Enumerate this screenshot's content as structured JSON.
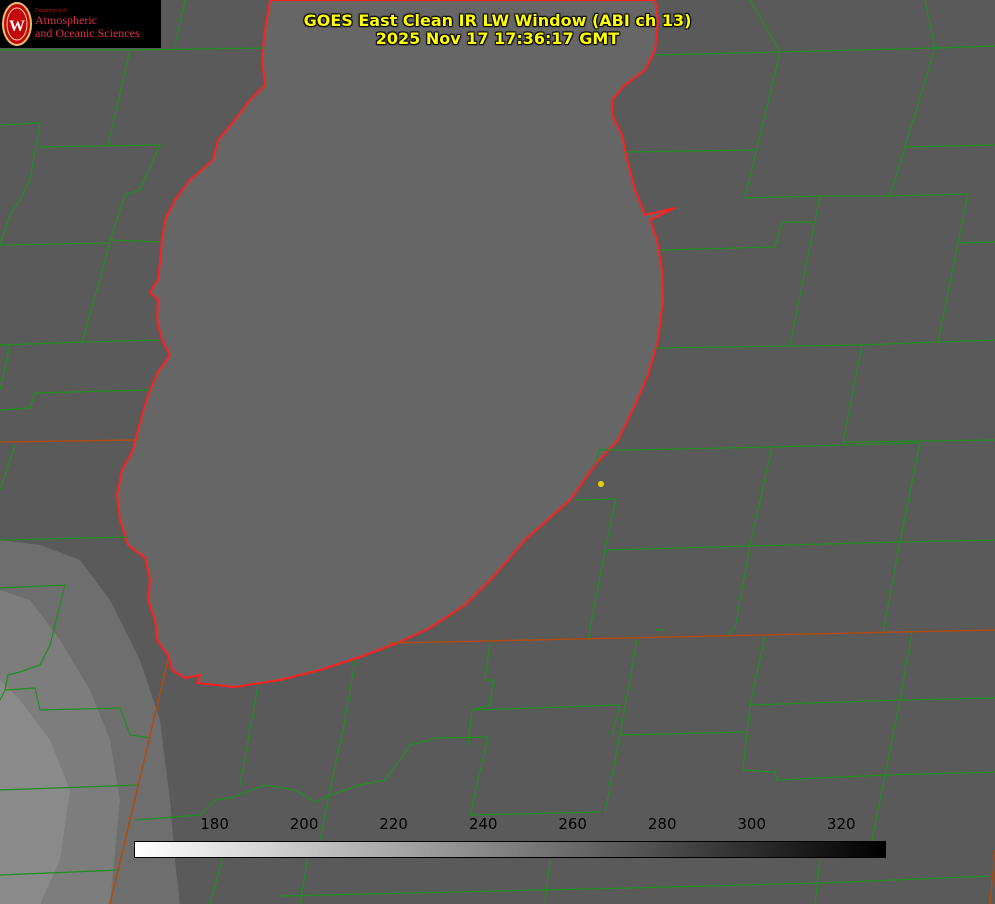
{
  "header": {
    "title_line1": "GOES East Clean IR LW Window (ABI ch 13)",
    "title_line2": "2025 Nov 17 17:36:17 GMT"
  },
  "logo": {
    "seal_letter": "W",
    "department": "Department of",
    "line1": "Atmospheric",
    "line2": "and Oceanic Sciences",
    "color": "#c5050c"
  },
  "colorbar": {
    "ticks": [
      "180",
      "200",
      "220",
      "240",
      "260",
      "280",
      "300",
      "320"
    ],
    "tick_values": [
      180,
      200,
      220,
      240,
      260,
      280,
      300,
      320
    ],
    "range": [
      162,
      330
    ],
    "start_color": "#ffffff",
    "end_color": "#000000"
  },
  "colors": {
    "coastline": "#ff2020",
    "county_lines": "#1f8f1f",
    "state_lines": "#b04a10",
    "title": "#ffff00",
    "marker": "#e8d000",
    "ground": "#5a5a5a",
    "lake": "#666666"
  }
}
